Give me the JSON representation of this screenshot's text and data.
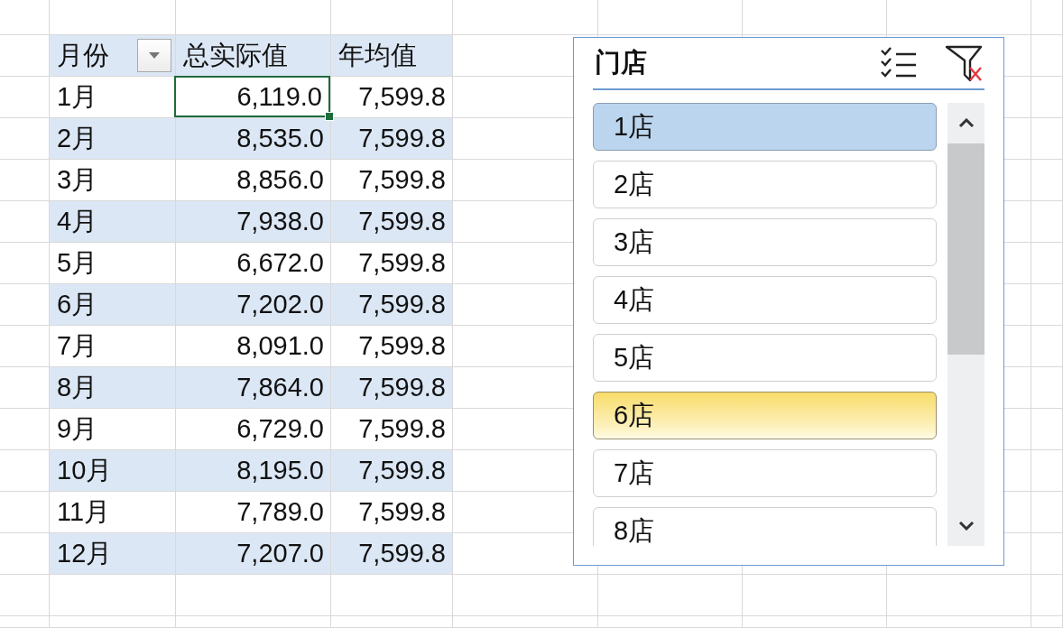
{
  "pivot_table": {
    "columns": [
      {
        "label": "月份",
        "has_filter": true
      },
      {
        "label": "总实际值",
        "has_filter": false
      },
      {
        "label": "年均值",
        "has_filter": false
      }
    ],
    "rows": [
      {
        "cells": [
          {
            "text": "1月",
            "selected": false
          },
          {
            "text": "6,119.0",
            "selected": true
          },
          {
            "text": "7,599.8",
            "selected": false
          }
        ]
      },
      {
        "cells": [
          {
            "text": "2月",
            "selected": false
          },
          {
            "text": "8,535.0",
            "selected": false
          },
          {
            "text": "7,599.8",
            "selected": false
          }
        ]
      },
      {
        "cells": [
          {
            "text": "3月",
            "selected": false
          },
          {
            "text": "8,856.0",
            "selected": false
          },
          {
            "text": "7,599.8",
            "selected": false
          }
        ]
      },
      {
        "cells": [
          {
            "text": "4月",
            "selected": false
          },
          {
            "text": "7,938.0",
            "selected": false
          },
          {
            "text": "7,599.8",
            "selected": false
          }
        ]
      },
      {
        "cells": [
          {
            "text": "5月",
            "selected": false
          },
          {
            "text": "6,672.0",
            "selected": false
          },
          {
            "text": "7,599.8",
            "selected": false
          }
        ]
      },
      {
        "cells": [
          {
            "text": "6月",
            "selected": false
          },
          {
            "text": "7,202.0",
            "selected": false
          },
          {
            "text": "7,599.8",
            "selected": false
          }
        ]
      },
      {
        "cells": [
          {
            "text": "7月",
            "selected": false
          },
          {
            "text": "8,091.0",
            "selected": false
          },
          {
            "text": "7,599.8",
            "selected": false
          }
        ]
      },
      {
        "cells": [
          {
            "text": "8月",
            "selected": false
          },
          {
            "text": "7,864.0",
            "selected": false
          },
          {
            "text": "7,599.8",
            "selected": false
          }
        ]
      },
      {
        "cells": [
          {
            "text": "9月",
            "selected": false
          },
          {
            "text": "6,729.0",
            "selected": false
          },
          {
            "text": "7,599.8",
            "selected": false
          }
        ]
      },
      {
        "cells": [
          {
            "text": "10月",
            "selected": false
          },
          {
            "text": "8,195.0",
            "selected": false
          },
          {
            "text": "7,599.8",
            "selected": false
          }
        ]
      },
      {
        "cells": [
          {
            "text": "11月",
            "selected": false
          },
          {
            "text": "7,789.0",
            "selected": false
          },
          {
            "text": "7,599.8",
            "selected": false
          }
        ]
      },
      {
        "cells": [
          {
            "text": "12月",
            "selected": false
          },
          {
            "text": "7,207.0",
            "selected": false
          },
          {
            "text": "7,599.8",
            "selected": false
          }
        ]
      }
    ]
  },
  "slicer": {
    "title": "门店",
    "items": [
      {
        "label": "1店",
        "selected": true,
        "hovered": false
      },
      {
        "label": "2店",
        "selected": false,
        "hovered": false
      },
      {
        "label": "3店",
        "selected": false,
        "hovered": false
      },
      {
        "label": "4店",
        "selected": false,
        "hovered": false
      },
      {
        "label": "5店",
        "selected": false,
        "hovered": false
      },
      {
        "label": "6店",
        "selected": false,
        "hovered": true
      },
      {
        "label": "7店",
        "selected": false,
        "hovered": false
      },
      {
        "label": "8店",
        "selected": false,
        "hovered": false
      }
    ]
  }
}
